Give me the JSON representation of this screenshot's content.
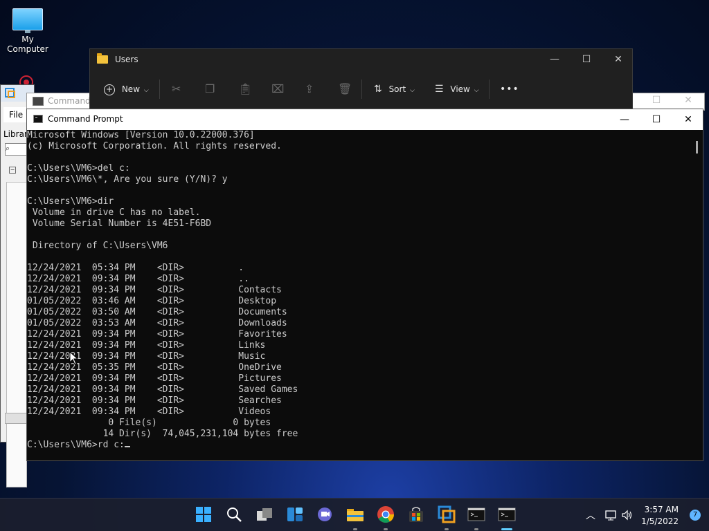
{
  "desktop": {
    "icons": [
      {
        "label": "My Computer",
        "icon": "monitor-icon"
      }
    ]
  },
  "background_window": {
    "menu_file": "File",
    "library_label": "Librar"
  },
  "background_cmd": {
    "title": "Command"
  },
  "explorer": {
    "title": "Users",
    "toolbar": {
      "new_label": "New",
      "sort_label": "Sort",
      "view_label": "View",
      "more_label": "•••"
    }
  },
  "cmd": {
    "title": "Command Prompt",
    "lines": [
      "Microsoft Windows [Version 10.0.22000.376]",
      "(c) Microsoft Corporation. All rights reserved.",
      "",
      "C:\\Users\\VM6>del c:",
      "C:\\Users\\VM6\\*, Are you sure (Y/N)? y",
      "",
      "C:\\Users\\VM6>dir",
      " Volume in drive C has no label.",
      " Volume Serial Number is 4E51-F6BD",
      "",
      " Directory of C:\\Users\\VM6",
      "",
      "12/24/2021  05:34 PM    <DIR>          .",
      "12/24/2021  09:34 PM    <DIR>          ..",
      "12/24/2021  09:34 PM    <DIR>          Contacts",
      "01/05/2022  03:46 AM    <DIR>          Desktop",
      "01/05/2022  03:50 AM    <DIR>          Documents",
      "01/05/2022  03:53 AM    <DIR>          Downloads",
      "12/24/2021  09:34 PM    <DIR>          Favorites",
      "12/24/2021  09:34 PM    <DIR>          Links",
      "12/24/2021  09:34 PM    <DIR>          Music",
      "12/24/2021  05:35 PM    <DIR>          OneDrive",
      "12/24/2021  09:34 PM    <DIR>          Pictures",
      "12/24/2021  09:34 PM    <DIR>          Saved Games",
      "12/24/2021  09:34 PM    <DIR>          Searches",
      "12/24/2021  09:34 PM    <DIR>          Videos",
      "               0 File(s)              0 bytes",
      "              14 Dir(s)  74,045,231,104 bytes free",
      ""
    ],
    "prompt": "C:\\Users\\VM6>rd c:"
  },
  "taskbar": {
    "apps": [
      {
        "name": "start",
        "icon": "windows-start-icon"
      },
      {
        "name": "search",
        "icon": "search-icon"
      },
      {
        "name": "task-view",
        "icon": "task-view-icon"
      },
      {
        "name": "widgets",
        "icon": "widgets-icon"
      },
      {
        "name": "teams-chat",
        "icon": "chat-icon"
      },
      {
        "name": "file-explorer",
        "icon": "folder-icon"
      },
      {
        "name": "chrome",
        "icon": "chrome-icon"
      },
      {
        "name": "store",
        "icon": "store-icon"
      },
      {
        "name": "vm-app",
        "icon": "app-icon"
      },
      {
        "name": "terminal-1",
        "icon": "terminal-icon"
      },
      {
        "name": "terminal-2",
        "icon": "terminal-icon"
      }
    ],
    "time": "3:57 AM",
    "date": "1/5/2022",
    "notification_count": "7"
  }
}
